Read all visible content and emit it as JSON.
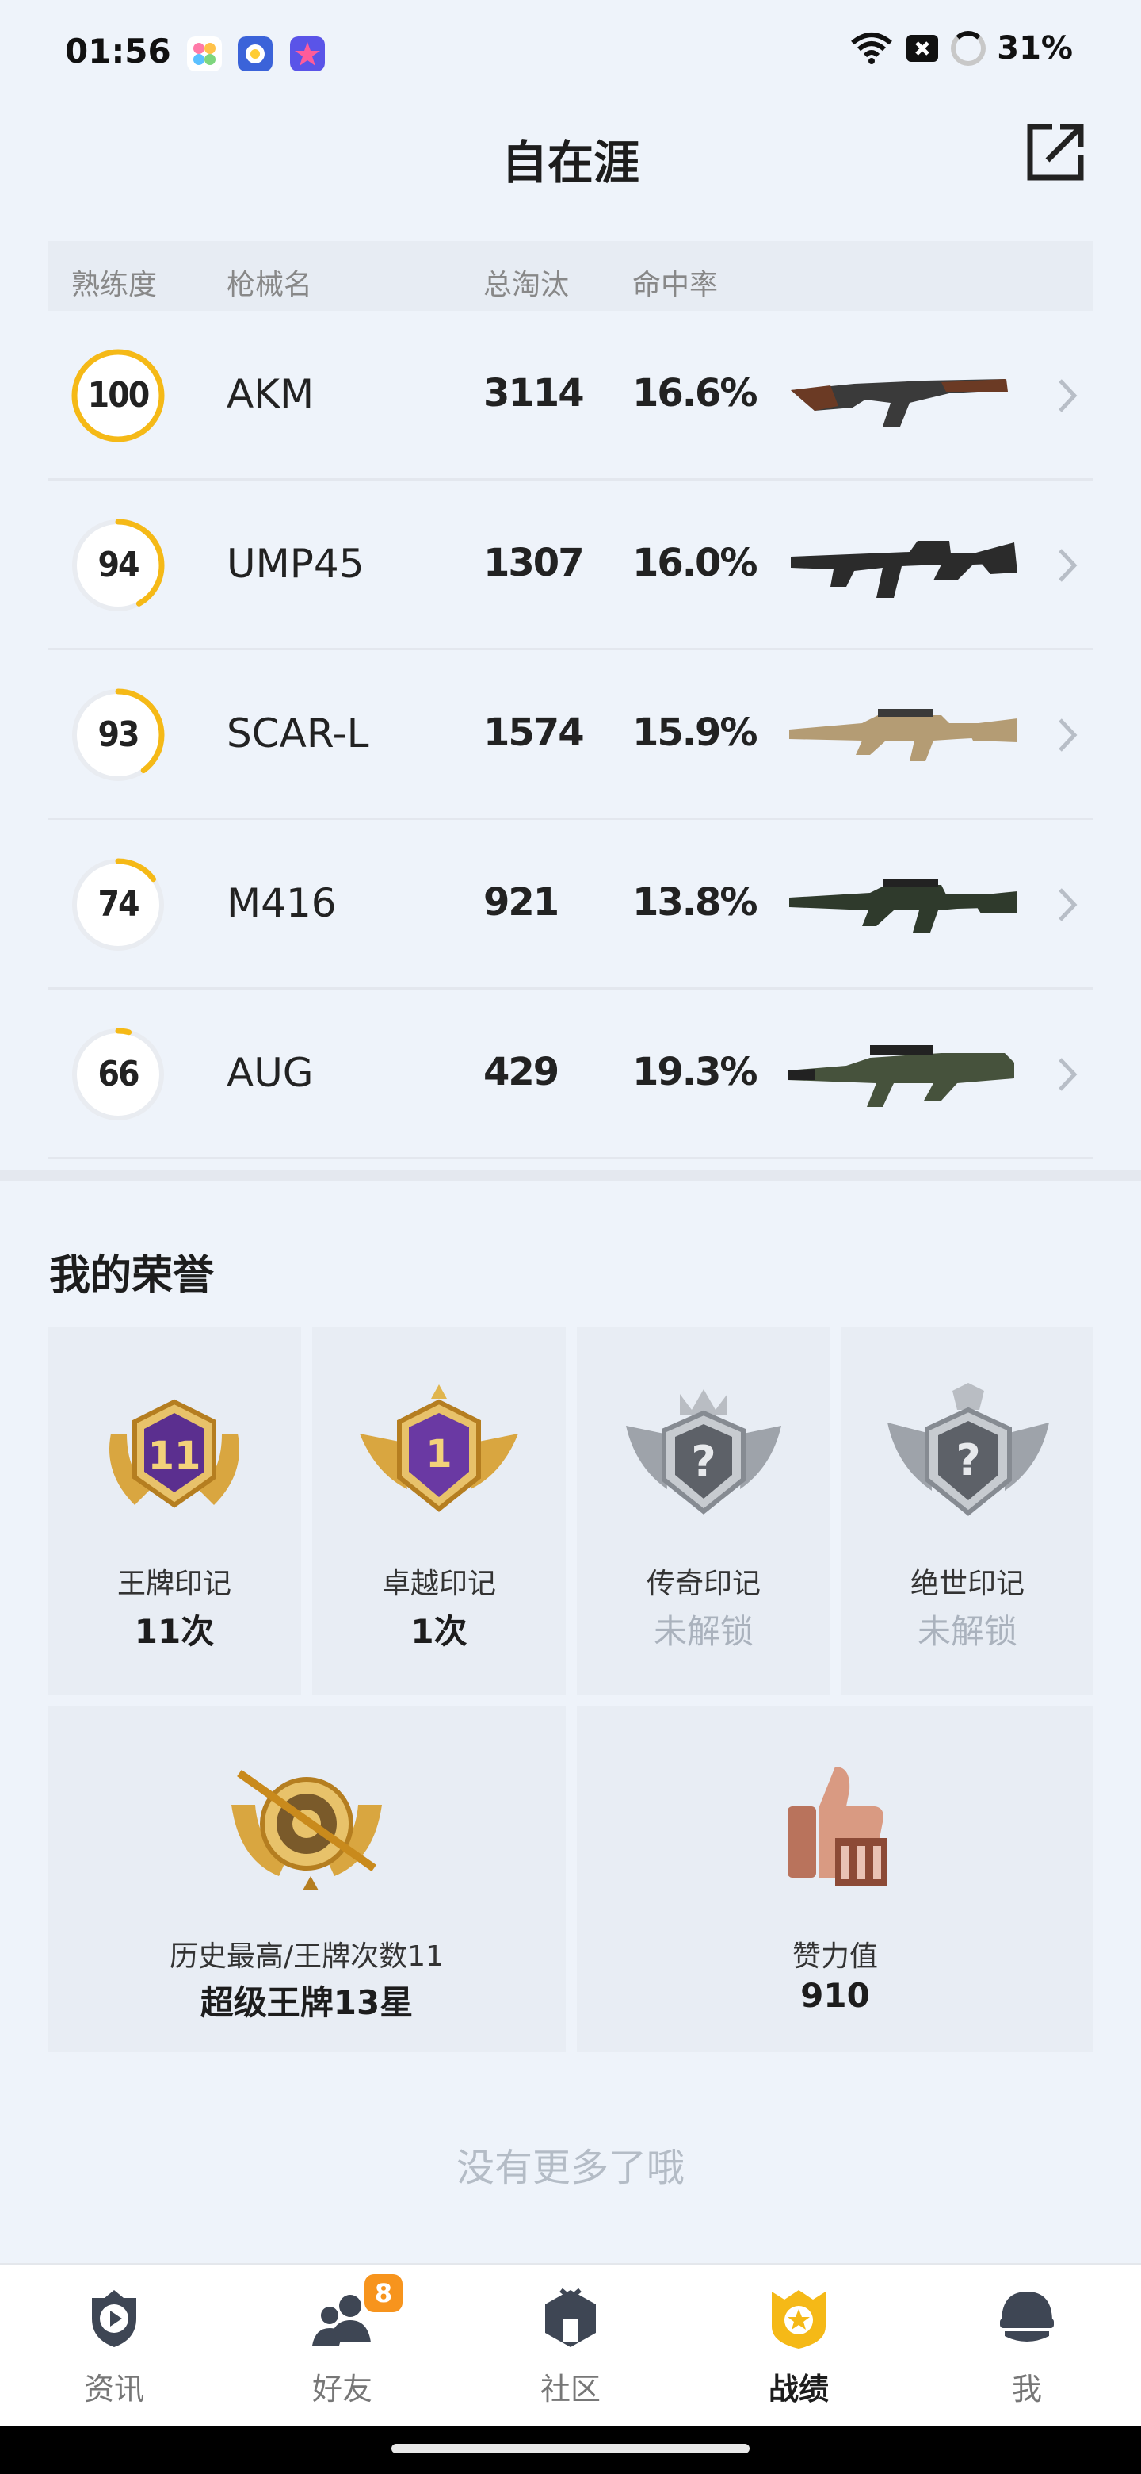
{
  "status_bar": {
    "time": "01:56",
    "battery": "31%"
  },
  "header": {
    "title": "自在涯"
  },
  "table": {
    "columns": [
      "熟练度",
      "枪械名",
      "总淘汰",
      "命中率"
    ],
    "rows": [
      {
        "proficiency": "100",
        "level": 1.0,
        "name": "AKM",
        "kills": "3114",
        "accuracy": "16.6%"
      },
      {
        "proficiency": "94",
        "level": 0.42,
        "name": "UMP45",
        "kills": "1307",
        "accuracy": "16.0%"
      },
      {
        "proficiency": "93",
        "level": 0.4,
        "name": "SCAR-L",
        "kills": "1574",
        "accuracy": "15.9%"
      },
      {
        "proficiency": "74",
        "level": 0.15,
        "name": "M416",
        "kills": "921",
        "accuracy": "13.8%"
      },
      {
        "proficiency": "66",
        "level": 0.04,
        "name": "AUG",
        "kills": "429",
        "accuracy": "19.3%"
      }
    ]
  },
  "honors": {
    "title": "我的荣誉",
    "marks": [
      {
        "label": "王牌印记",
        "value": "11次",
        "badge_text": "11",
        "locked": false
      },
      {
        "label": "卓越印记",
        "value": "1次",
        "badge_text": "1",
        "locked": false
      },
      {
        "label": "传奇印记",
        "value": "未解锁",
        "badge_text": "?",
        "locked": true
      },
      {
        "label": "绝世印记",
        "value": "未解锁",
        "badge_text": "?",
        "locked": true
      }
    ],
    "wide": [
      {
        "label": "历史最高/王牌次数11",
        "value": "超级王牌13星"
      },
      {
        "label": "赞力值",
        "value": "910"
      }
    ]
  },
  "footer_text": "没有更多了哦",
  "nav": {
    "items": [
      {
        "label": "资讯",
        "icon": "news-icon",
        "active": false
      },
      {
        "label": "好友",
        "icon": "friends-icon",
        "active": false,
        "badge": "8"
      },
      {
        "label": "社区",
        "icon": "community-icon",
        "active": false
      },
      {
        "label": "战绩",
        "icon": "record-icon",
        "active": true
      },
      {
        "label": "我",
        "icon": "profile-icon",
        "active": false
      }
    ]
  },
  "colors": {
    "accent": "#f5b917",
    "background": "#eef3fa",
    "card": "#e8edf4",
    "locked_text": "#aab2bd"
  }
}
